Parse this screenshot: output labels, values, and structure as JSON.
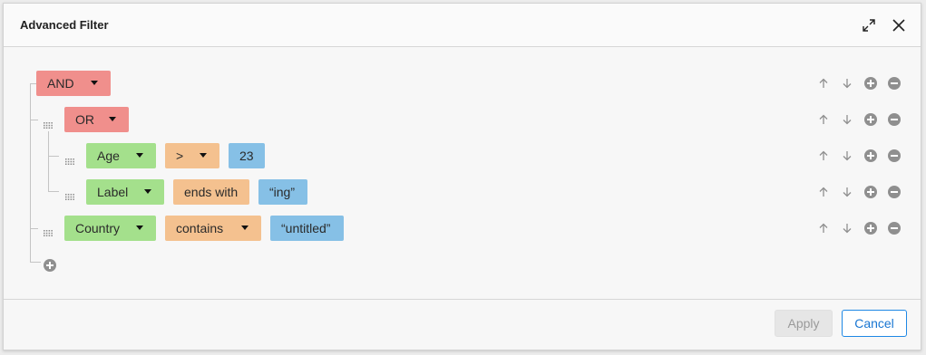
{
  "dialog": {
    "title": "Advanced Filter",
    "apply_label": "Apply",
    "cancel_label": "Cancel"
  },
  "icons": {
    "expand": "expand-icon",
    "close": "close-icon",
    "drag": "drag-handle-icon",
    "move_up": "arrow-up-icon",
    "move_down": "arrow-down-icon",
    "add": "add-circle-icon",
    "remove": "remove-circle-icon"
  },
  "colors": {
    "join": "#f08f8c",
    "column": "#a4e08c",
    "operator": "#f4c18f",
    "value": "#86c0e6",
    "accent": "#1976d2"
  },
  "tree": {
    "root": {
      "join": "AND"
    },
    "group": {
      "join": "OR"
    },
    "conditions": [
      {
        "column": "Age",
        "operator": ">",
        "value": "23"
      },
      {
        "column": "Label",
        "operator": "ends with",
        "value": "“ing”"
      },
      {
        "column": "Country",
        "operator": "contains",
        "value": "“untitled”"
      }
    ]
  }
}
